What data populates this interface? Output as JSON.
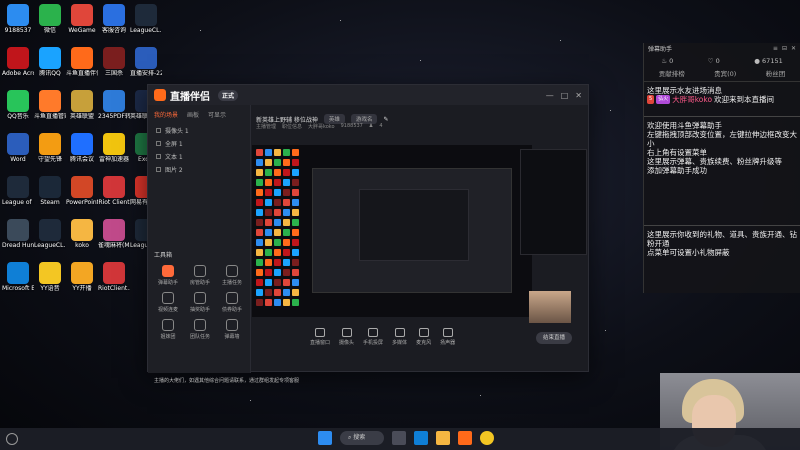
{
  "desktop": {
    "icons": [
      {
        "label": "9188537",
        "color": "#2c8cf0"
      },
      {
        "label": "微信",
        "color": "#2bb24c"
      },
      {
        "label": "WeGame",
        "color": "#e0463a"
      },
      {
        "label": "客服咨询",
        "color": "#2a6fe0"
      },
      {
        "label": "LeagueCL... - 快捷方式",
        "color": "#1e2a3a"
      },
      {
        "label": "Adobe Acrobat",
        "color": "#c0151b"
      },
      {
        "label": "腾讯QQ",
        "color": "#1aa3ff"
      },
      {
        "label": "斗鱼直播伴侣",
        "color": "#ff6a1a"
      },
      {
        "label": "三国杀",
        "color": "#7a1e1e"
      },
      {
        "label": "直播安排-221126...",
        "color": "#2b5dbb"
      },
      {
        "label": "QQ音乐",
        "color": "#28c45a"
      },
      {
        "label": "斗鱼直播管家",
        "color": "#ff7a2a"
      },
      {
        "label": "英雄联盟",
        "color": "#c7a03a"
      },
      {
        "label": "2345PDF转换器",
        "color": "#2e7bd8"
      },
      {
        "label": "英雄联盟WeGame版",
        "color": "#1c2a48"
      },
      {
        "label": "Word",
        "color": "#2b5dbb"
      },
      {
        "label": "守望先锋",
        "color": "#f39c12"
      },
      {
        "label": "腾讯会议",
        "color": "#1f6fff"
      },
      {
        "label": "雷神加速器",
        "color": "#f1c40f"
      },
      {
        "label": "Excel",
        "color": "#1f7a45"
      },
      {
        "label": "League of Legends",
        "color": "#1e2a3a"
      },
      {
        "label": "Steam",
        "color": "#1b2838"
      },
      {
        "label": "PowerPoint",
        "color": "#d24726"
      },
      {
        "label": "Riot Client",
        "color": "#d13639"
      },
      {
        "label": "网易有道词典",
        "color": "#e0352b"
      },
      {
        "label": "Dread Hunger",
        "color": "#3b4a5a"
      },
      {
        "label": "LeagueCL... - 快捷方式",
        "color": "#1e2a3a"
      },
      {
        "label": "koko",
        "color": "#f5b642"
      },
      {
        "label": "雀魂麻将(Mahjong...)",
        "color": "#c04a8a"
      },
      {
        "label": "League of Legends",
        "color": "#1e2a3a"
      },
      {
        "label": "Microsoft Edge",
        "color": "#0f7fd6"
      },
      {
        "label": "YY语音",
        "color": "#f3c623"
      },
      {
        "label": "YY开播",
        "color": "#f3a623"
      },
      {
        "label": "RiotClient... - 快捷方式",
        "color": "#d13639"
      }
    ]
  },
  "app": {
    "name": "直播伴侣",
    "version": "正式",
    "tabs": [
      "我的场景",
      "画板",
      "可显示"
    ],
    "scenes": [
      "摄像头 1",
      "全屏 1",
      "文本 1",
      "图片 2"
    ],
    "room_title": "新英雄上野辅 移位战神",
    "category_pill": "英雄",
    "category_value": "游戏名",
    "sub_info": [
      "主播管理",
      "职位信息",
      "大胖哥koko",
      "9188537"
    ],
    "viewer_count": "4",
    "tools_header": "工具箱",
    "tools": [
      "弹幕助手",
      "房管助手",
      "主播任务",
      "视频连麦",
      "抽奖助手",
      "债券助手",
      "姐妹团",
      "团队任务",
      "弹幕墙"
    ],
    "bottom_buttons": [
      "直播窗口",
      "摄像头",
      "手机投屏",
      "多媒体",
      "麦克风",
      "扬声器"
    ],
    "go_live": "结束直播",
    "notice": "主播的大佬们，如遇其他综合问题请联系，通过群组发起专项客服"
  },
  "danmaku": {
    "title": "弹幕助手",
    "stats": [
      "0",
      "0",
      "67151"
    ],
    "tabs": [
      "贡献排榜",
      "贵宾(0)",
      "粉丝团"
    ],
    "system_msg": "这里展示水友进场消息",
    "chat": {
      "badge": "弘火",
      "badge2": "5",
      "user": "大胖哥koko",
      "text": "欢迎来到本直播间"
    },
    "help_lines": [
      "欢迎使用斗鱼弹幕助手",
      "左键拖拽顶部改变位置，左键拉伸边框改变大小",
      "右上角有设置菜单",
      "这里展示弹幕、贵族续费、粉丝牌升级等",
      "添加弹幕助手成功"
    ],
    "gift_lines": [
      "这里展示你收到的礼物、道具、贵族开通、钻粉开通",
      "点菜单可设置小礼物屏蔽"
    ]
  },
  "taskbar": {
    "search_label": "搜索"
  }
}
